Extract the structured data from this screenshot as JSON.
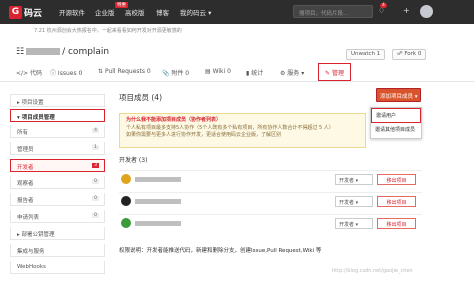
{
  "topbar": {
    "logo_text": "码云",
    "logo_glyph": "G",
    "nav": [
      "开源软件",
      "企业版",
      "高校版",
      "博客",
      "我的码云 ▾"
    ],
    "badge": "特惠",
    "search_placeholder": "搜项目，代码片段...",
    "notification_count": "4",
    "plus_icon": "+",
    "bell_icon": "bell-icon"
  },
  "notice": "7.21 杭州源创会大热报名中，一起来看看如何开发对开源更敏感的",
  "repo": {
    "name": "complain",
    "unwatch_label": "Unwatch",
    "unwatch_count": "1",
    "fork_label": "Fork",
    "fork_count": "0"
  },
  "tabs": [
    "代码",
    "Issues 0",
    "Pull Requests 0",
    "附件 0",
    "Wiki 0",
    "统计",
    "服务 ▾",
    "管理"
  ],
  "sidebar": [
    {
      "label": "项目设置",
      "count": ""
    },
    {
      "label": "项目成员管理",
      "count": ""
    },
    {
      "label": "所有",
      "count": "4"
    },
    {
      "label": "管理员",
      "count": "1"
    },
    {
      "label": "开发者",
      "count": "3"
    },
    {
      "label": "观察者",
      "count": "0"
    },
    {
      "label": "报告者",
      "count": "0"
    },
    {
      "label": "申请列表",
      "count": "0"
    },
    {
      "label": "部署公钥管理",
      "count": ""
    },
    {
      "label": "集成与服务",
      "count": ""
    },
    {
      "label": "WebHooks",
      "count": ""
    }
  ],
  "main": {
    "title": "项目成员 (4)",
    "add_button": "添加项目成员 ▾",
    "dropdown": [
      "邀请用户",
      "邀请其他项目成员"
    ],
    "warning_title": "为什么我不能添加项目成员（协作者列表）",
    "warning_lines": [
      "个人私有项目最多支持5人协作（5个人既有多个私有项目，所有协作人数合计不得超过 5 人）",
      "如果你需要与更多人进行协作开发，更适合使用码云企业版，了解区别"
    ],
    "developers_header": "开发者 (3)",
    "members": [
      {
        "role": "开发者 ▾",
        "remove": "移出项目"
      },
      {
        "role": "开发者 ▾",
        "remove": "移出项目"
      },
      {
        "role": "开发者 ▾",
        "remove": "移出项目"
      }
    ],
    "permission_note": "权限说明：开发者能推送代码，新建和删除分支，创建Issue,Pull Request,Wiki 等"
  },
  "watermark": "http://blog.csdn.net/gaojie_chen",
  "colors": {
    "accent": "#d9242f",
    "topbar": "#2d2d2d"
  }
}
